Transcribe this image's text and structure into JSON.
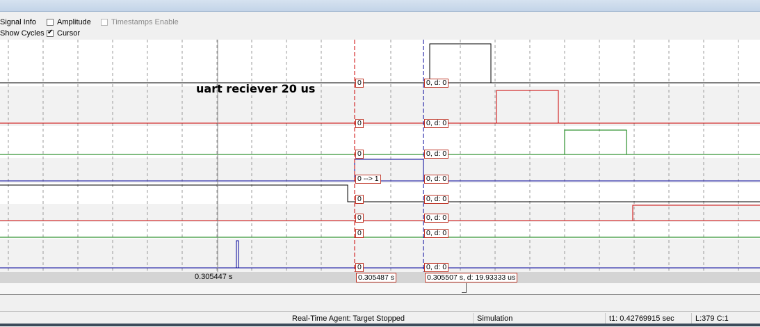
{
  "options": {
    "signal_info": "Signal Info",
    "amplitude": "Amplitude",
    "timestamps_enable": "Timestamps Enable",
    "show_cycles": "Show Cycles",
    "cursor": "Cursor",
    "amplitude_checked": false,
    "timestamps_checked": false,
    "cursor_checked": true
  },
  "annotation": "uart reciever 20 us",
  "cursor_markers": {
    "c1": [
      "0",
      "0",
      "0",
      "0 --> 1",
      "0",
      "0",
      "0",
      "0"
    ],
    "c2": [
      "0,  d: 0",
      "0,  d: 0",
      "0,  d: 0",
      "0,  d: 0",
      "0,  d: 0",
      "0,  d: 0",
      "0,  d: 0",
      "0,  d: 0"
    ]
  },
  "time_axis": {
    "left_time": "0.305447 s",
    "cursor1_time": "0.305487 s",
    "cursor2_time": "0.305507 s,  d: 19.93333 us"
  },
  "status_bar": {
    "agent": "Real-Time Agent: Target Stopped",
    "mode": "Simulation",
    "t1": "t1: 0.42769915 sec",
    "position": "L:379 C:1"
  },
  "colors": {
    "black": "#000000",
    "red": "#cc0000",
    "green": "#007a00",
    "blue": "#000099",
    "marker_border": "#c0392b"
  }
}
